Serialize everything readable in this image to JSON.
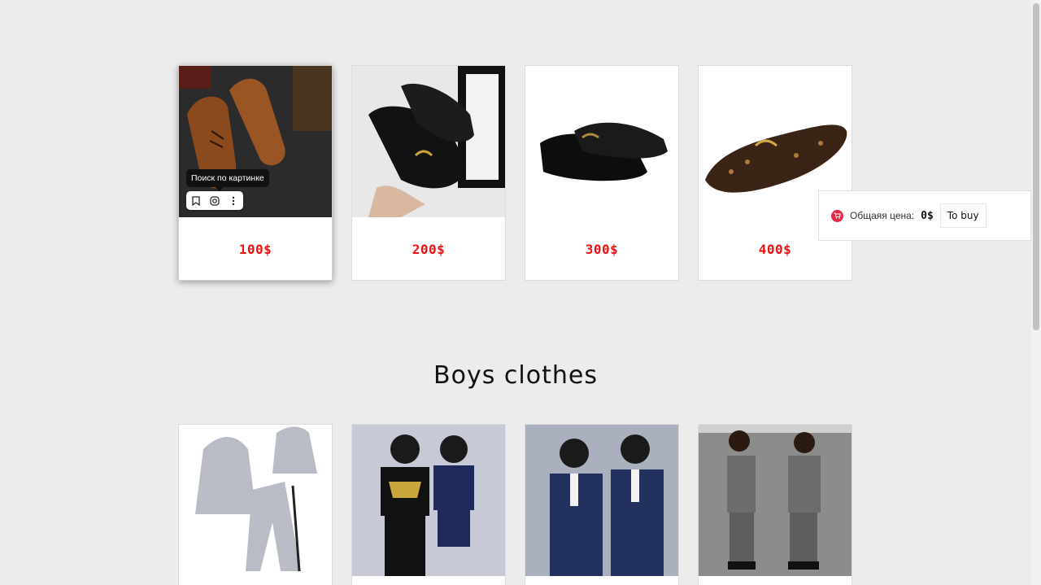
{
  "products_shoes": [
    {
      "price": "100$",
      "image": "brown-oxford-shoes"
    },
    {
      "price": "200$",
      "image": "black-loafers-in-hand"
    },
    {
      "price": "300$",
      "image": "black-patent-shoes"
    },
    {
      "price": "400$",
      "image": "monogram-loafer"
    }
  ],
  "image_tooltip": {
    "text": "Поиск по картинке",
    "icons": [
      "bookmark-icon",
      "lens-search-icon",
      "more-vertical-icon"
    ]
  },
  "cart": {
    "label": "Общаяя цена:",
    "total": "0$",
    "buy_label": "To buy",
    "icon": "cart-icon",
    "accent": "#e12c46"
  },
  "section": {
    "title": "Boys clothes"
  },
  "products_boys": [
    {
      "image": "grey-tracksuit"
    },
    {
      "image": "boys-tshirt-set"
    },
    {
      "image": "boys-navy-suit"
    },
    {
      "image": "boys-grey-suit"
    }
  ],
  "colors": {
    "price": "#ee1111",
    "background": "#ececec"
  }
}
